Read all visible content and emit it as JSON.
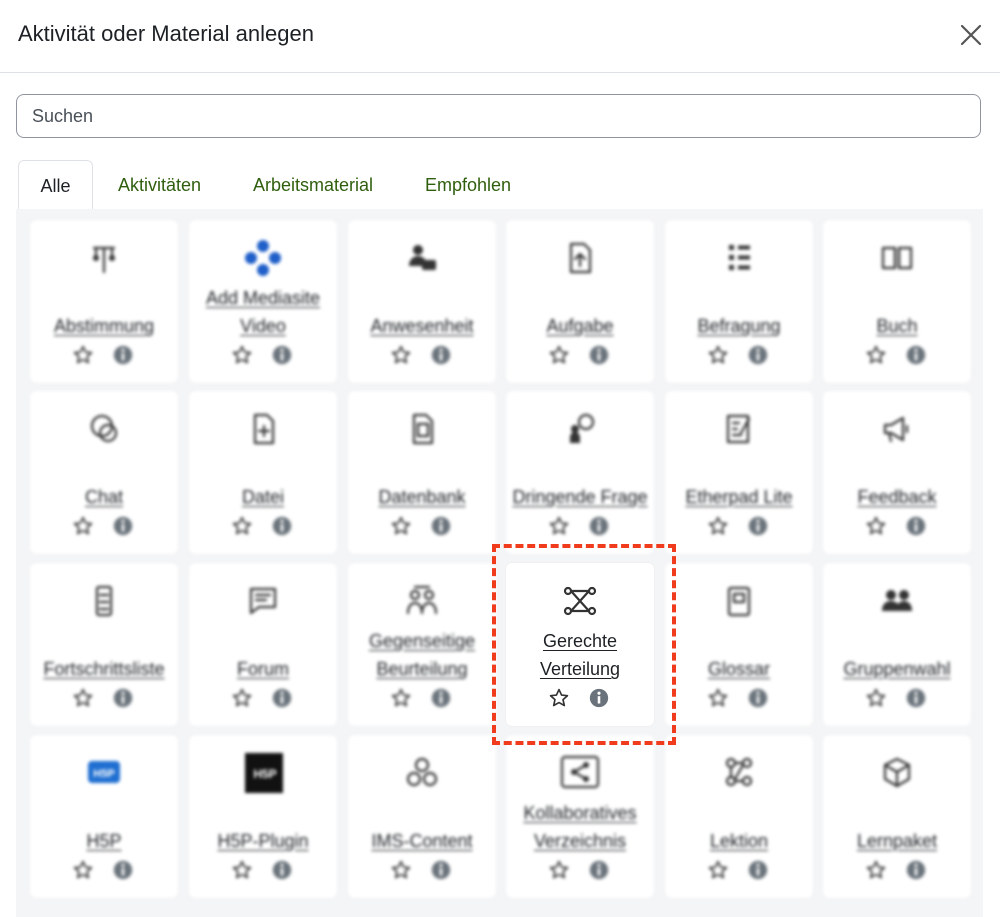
{
  "dialog": {
    "title": "Aktivität oder Material anlegen",
    "close_icon": "close-icon"
  },
  "search": {
    "placeholder": "Suchen",
    "value": ""
  },
  "tabs": [
    {
      "label": "Alle",
      "active": true
    },
    {
      "label": "Aktivitäten",
      "active": false
    },
    {
      "label": "Arbeitsmaterial",
      "active": false
    },
    {
      "label": "Empfohlen",
      "active": false
    }
  ],
  "colors": {
    "tab_link": "#2f5f0e",
    "highlight": "#f03b1c",
    "grid_bg": "#f4f5f7"
  },
  "modules": [
    {
      "name": "Abstimmung",
      "icon": "choice-icon"
    },
    {
      "name": "Add Mediasite Video",
      "icon": "mediasite-icon"
    },
    {
      "name": "Anwesenheit",
      "icon": "attendance-icon"
    },
    {
      "name": "Aufgabe",
      "icon": "assignment-icon"
    },
    {
      "name": "Befragung",
      "icon": "survey-icon"
    },
    {
      "name": "Buch",
      "icon": "book-icon"
    },
    {
      "name": "Chat",
      "icon": "chat-icon"
    },
    {
      "name": "Datei",
      "icon": "file-icon"
    },
    {
      "name": "Datenbank",
      "icon": "database-icon"
    },
    {
      "name": "Dringende Frage",
      "icon": "urgent-question-icon"
    },
    {
      "name": "Etherpad Lite",
      "icon": "etherpad-icon"
    },
    {
      "name": "Feedback",
      "icon": "feedback-icon"
    },
    {
      "name": "Fortschrittsliste",
      "icon": "checklist-icon"
    },
    {
      "name": "Forum",
      "icon": "forum-icon"
    },
    {
      "name": "Gegenseitige Beurteilung",
      "icon": "workshop-icon"
    },
    {
      "name": "Gerechte Verteilung",
      "icon": "distribution-icon"
    },
    {
      "name": "Glossar",
      "icon": "glossary-icon"
    },
    {
      "name": "Gruppenwahl",
      "icon": "group-choice-icon"
    },
    {
      "name": "H5P",
      "icon": "h5p-icon"
    },
    {
      "name": "H5P-Plugin",
      "icon": "h5p-plugin-icon"
    },
    {
      "name": "IMS-Content",
      "icon": "ims-content-icon"
    },
    {
      "name": "Kollaboratives Verzeichnis",
      "icon": "shared-folder-icon"
    },
    {
      "name": "Lektion",
      "icon": "lesson-icon"
    },
    {
      "name": "Lernpaket",
      "icon": "package-icon"
    }
  ],
  "card_actions": {
    "star_icon": "star-outline-icon",
    "info_icon": "info-icon"
  }
}
